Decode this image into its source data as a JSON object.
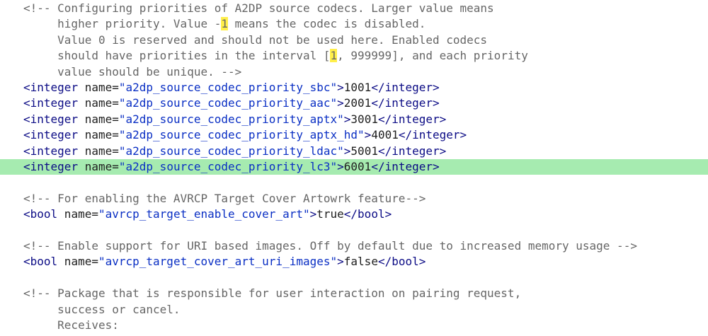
{
  "editor": {
    "lines": [
      {
        "kind": "comment",
        "parts": [
          {
            "t": "<!-- Configuring priorities of A2DP source codecs. Larger value means"
          }
        ]
      },
      {
        "kind": "comment",
        "parts": [
          {
            "t": "     higher priority. Value -"
          },
          {
            "t": "1",
            "mark": true
          },
          {
            "t": " means the codec is disabled."
          }
        ]
      },
      {
        "kind": "comment",
        "parts": [
          {
            "t": "     Value 0 is reserved and should not be used here. Enabled codecs"
          }
        ]
      },
      {
        "kind": "comment",
        "parts": [
          {
            "t": "     should have priorities in the interval ["
          },
          {
            "t": "1",
            "mark": true
          },
          {
            "t": ", 999999], and each priority"
          }
        ]
      },
      {
        "kind": "comment",
        "parts": [
          {
            "t": "     value should be unique. -->"
          }
        ]
      },
      {
        "kind": "tag",
        "tag": "integer",
        "name": "a2dp_source_codec_priority_sbc",
        "value": "1001"
      },
      {
        "kind": "tag",
        "tag": "integer",
        "name": "a2dp_source_codec_priority_aac",
        "value": "2001"
      },
      {
        "kind": "tag",
        "tag": "integer",
        "name": "a2dp_source_codec_priority_aptx",
        "value": "3001"
      },
      {
        "kind": "tag",
        "tag": "integer",
        "name": "a2dp_source_codec_priority_aptx_hd",
        "value": "4001"
      },
      {
        "kind": "tag",
        "tag": "integer",
        "name": "a2dp_source_codec_priority_ldac",
        "value": "5001"
      },
      {
        "kind": "tag",
        "tag": "integer",
        "name": "a2dp_source_codec_priority_lc3",
        "value": "6001",
        "highlight": true
      },
      {
        "kind": "blank"
      },
      {
        "kind": "comment",
        "parts": [
          {
            "t": "<!-- For enabling the AVRCP Target Cover Artowrk feature-->"
          }
        ]
      },
      {
        "kind": "tag",
        "tag": "bool",
        "name": "avrcp_target_enable_cover_art",
        "value": "true"
      },
      {
        "kind": "blank"
      },
      {
        "kind": "comment",
        "parts": [
          {
            "t": "<!-- Enable support for URI based images. Off by default due to increased memory usage -->"
          }
        ]
      },
      {
        "kind": "tag",
        "tag": "bool",
        "name": "avrcp_target_cover_art_uri_images",
        "value": "false"
      },
      {
        "kind": "blank"
      },
      {
        "kind": "comment",
        "parts": [
          {
            "t": "<!-- Package that is responsible for user interaction on pairing request,"
          }
        ]
      },
      {
        "kind": "comment",
        "parts": [
          {
            "t": "     success or cancel."
          }
        ]
      },
      {
        "kind": "comment",
        "parts": [
          {
            "t": "     Receives:"
          }
        ]
      }
    ]
  },
  "colors": {
    "highlight_line": "#a6ebb0",
    "search_match": "#ffef4a",
    "comment": "#666666",
    "tag": "#0b0b85",
    "attribute_value": "#0a2fc4"
  }
}
